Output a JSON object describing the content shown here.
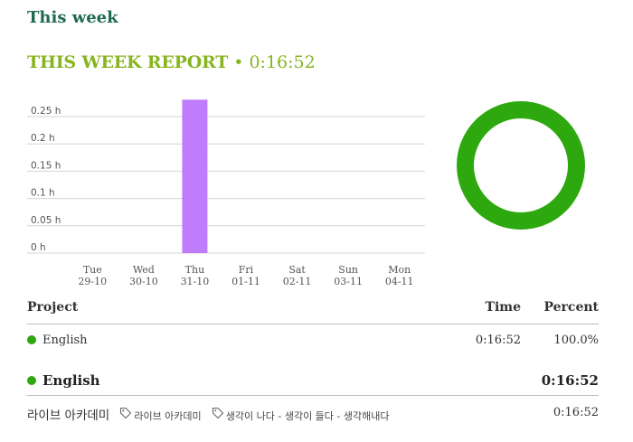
{
  "page": {
    "title": "This week"
  },
  "report": {
    "label": "THIS WEEK REPORT",
    "separator": "•",
    "total": "0:16:52"
  },
  "colors": {
    "accent": "#86b520",
    "title": "#1f6b50",
    "bar": "#bf7dfb",
    "donut": "#2da80f",
    "project": "#2da80f"
  },
  "chart_data": [
    {
      "type": "bar",
      "categories": [
        "Tue\n29-10",
        "Wed\n30-10",
        "Thu\n31-10",
        "Fri\n01-11",
        "Sat\n02-11",
        "Sun\n03-11",
        "Mon\n04-11"
      ],
      "day_names": [
        "Tue",
        "Wed",
        "Thu",
        "Fri",
        "Sat",
        "Sun",
        "Mon"
      ],
      "day_dates": [
        "29-10",
        "30-10",
        "31-10",
        "01-11",
        "02-11",
        "03-11",
        "04-11"
      ],
      "values": [
        0,
        0,
        0.281,
        0,
        0,
        0,
        0
      ],
      "ylim": [
        0,
        0.25
      ],
      "yticks": [
        0,
        0.05,
        0.1,
        0.15,
        0.2,
        0.25
      ],
      "ytick_labels": [
        "0 h",
        "0.05 h",
        "0.1 h",
        "0.15 h",
        "0.2 h",
        "0.25 h"
      ],
      "grid": true,
      "title": "",
      "xlabel": "",
      "ylabel": ""
    },
    {
      "type": "pie",
      "style": "donut",
      "labels": [
        "English"
      ],
      "values": [
        100.0
      ],
      "colors": [
        "#2da80f"
      ]
    }
  ],
  "table": {
    "headers": {
      "project": "Project",
      "time": "Time",
      "percent": "Percent"
    },
    "rows": [
      {
        "project": "English",
        "time": "0:16:52",
        "percent": "100.0%"
      }
    ]
  },
  "group": {
    "name": "English",
    "time": "0:16:52"
  },
  "entry": {
    "description": "라이브 아카데미",
    "tags": [
      "라이브 아카데미",
      "생각이 나다 - 생각이 들다 - 생각해내다"
    ],
    "tag_icon": "tag-icon",
    "time": "0:16:52"
  }
}
